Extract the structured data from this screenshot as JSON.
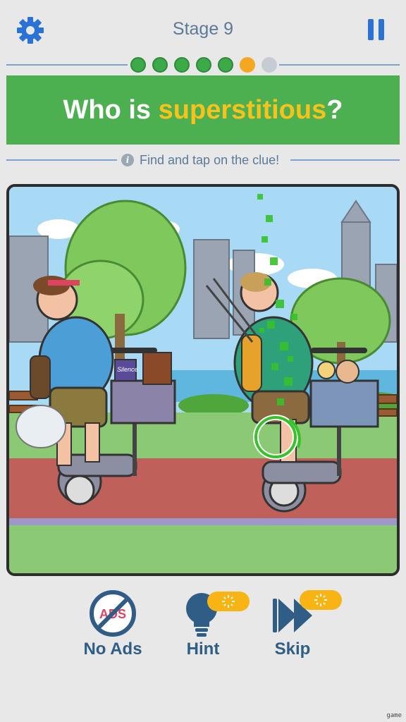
{
  "header": {
    "stage_label": "Stage 9",
    "settings_icon": "gear-icon",
    "pause_icon": "pause-icon"
  },
  "progress": {
    "total": 7,
    "completed": 5,
    "current_index": 5,
    "colors": {
      "done": "#3daa4a",
      "current": "#f5a623",
      "pending": "#c6ccd3"
    }
  },
  "banner": {
    "question_prefix": "Who is ",
    "question_highlight": "superstitious",
    "question_suffix": "?",
    "background": "#4caf50",
    "highlight_color": "#f7c21c"
  },
  "instruction": {
    "icon": "info-icon",
    "icon_glyph": "i",
    "text": "Find and tap on the clue!"
  },
  "scene": {
    "description_icon": "puzzle-scene",
    "sticker_text": "Silence"
  },
  "actions": {
    "no_ads_label": "No Ads",
    "no_ads_icon_text": "ADS",
    "hint_label": "Hint",
    "skip_label": "Skip"
  },
  "watermark": "game",
  "colors": {
    "accent_blue": "#2a72d6",
    "label_blue": "#2f5d86",
    "badge_orange": "#f7b413"
  }
}
